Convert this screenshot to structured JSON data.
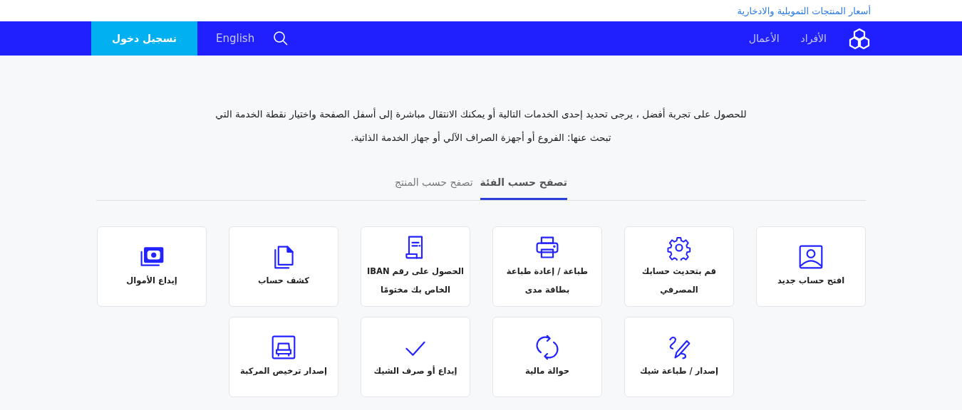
{
  "top_link": "أسعار المنتجات التمويلية والادخارية",
  "nav": {
    "items": [
      {
        "label": "الأفراد"
      },
      {
        "label": "الأعمال"
      }
    ],
    "language": "English",
    "login": "تسجيل دخول"
  },
  "intro": "للحصول على تجربة أفضل ، يرجى تحديد إحدى الخدمات التالية أو يمكنك الانتقال مباشرة إلى أسفل الصفحة واختيار نقطة الخدمة التي تبحث عنها: الفروع أو أجهزة الصراف الآلي أو جهاز الخدمة الذاتية.",
  "tabs": [
    {
      "label": "تصفح حسب الفئة",
      "selected": true
    },
    {
      "label": "تصفح حسب المنتج",
      "selected": false
    }
  ],
  "services": [
    {
      "kind": "person",
      "label": "افتح حساب جديد"
    },
    {
      "kind": "gear",
      "label": "قم بتحديث حسابك المصرفي"
    },
    {
      "kind": "printer",
      "label": "طباعة / إعادة طباعة بطاقة مدى"
    },
    {
      "kind": "receipt",
      "label": "الحصول على رقم IBAN الخاص بك مختومًا"
    },
    {
      "kind": "documents",
      "label": "كشف حساب"
    },
    {
      "kind": "money",
      "label": "إيداع الأموال"
    },
    {
      "kind": "pencil",
      "label": "إصدار / طباعة شيك"
    },
    {
      "kind": "cycle",
      "label": "حوالة مالية"
    },
    {
      "kind": "check",
      "label": "إيداع أو صرف الشيك"
    },
    {
      "kind": "car",
      "label": "إصدار ترخيص المركبة"
    }
  ]
}
